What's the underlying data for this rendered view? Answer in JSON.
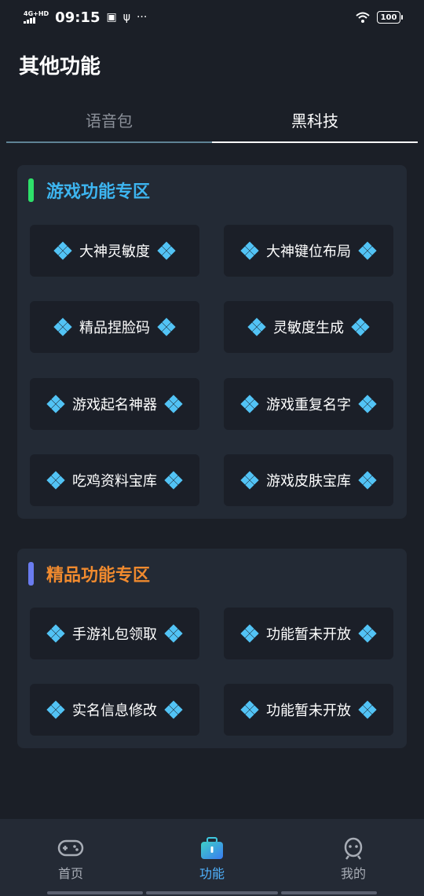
{
  "status_bar": {
    "network": "4G+HD",
    "time": "09:15",
    "battery": "100"
  },
  "page": {
    "title": "其他功能"
  },
  "tabs": [
    {
      "label": "语音包",
      "active": false
    },
    {
      "label": "黑科技",
      "active": true
    }
  ],
  "sections": [
    {
      "title": "游戏功能专区",
      "title_color": "#3db5f0",
      "bar_color": "#2ee06a",
      "buttons": [
        "大神灵敏度",
        "大神键位布局",
        "精品捏脸码",
        "灵敏度生成",
        "游戏起名神器",
        "游戏重复名字",
        "吃鸡资料宝库",
        "游戏皮肤宝库"
      ]
    },
    {
      "title": "精品功能专区",
      "title_color": "#f08a2e",
      "bar_color": "#6a7cf0",
      "buttons": [
        "手游礼包领取",
        "功能暂未开放",
        "实名信息修改",
        "功能暂未开放"
      ]
    }
  ],
  "bottom_nav": [
    {
      "label": "首页",
      "icon": "gamepad-icon",
      "active": false
    },
    {
      "label": "功能",
      "icon": "toolbox-icon",
      "active": true
    },
    {
      "label": "我的",
      "icon": "robot-face-icon",
      "active": false
    }
  ],
  "colors": {
    "background": "#1b1f27",
    "card": "#232a35",
    "button": "#1b1f28",
    "accent": "#4fb3ff",
    "icon": "#52c3f5"
  }
}
